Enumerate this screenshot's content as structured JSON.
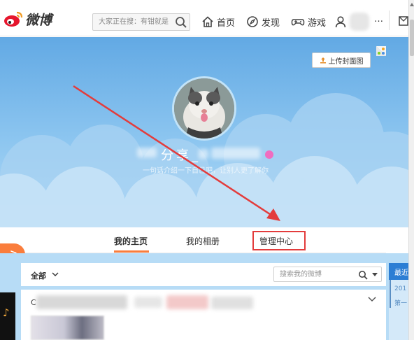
{
  "brand": {
    "logo_text": "微博"
  },
  "topnav": {
    "search_placeholder": "大家正在搜：有钳就是",
    "items": [
      {
        "label": "首页",
        "icon": "home-icon"
      },
      {
        "label": "发现",
        "icon": "compass-icon"
      },
      {
        "label": "游戏",
        "icon": "gamepad-icon"
      }
    ],
    "user_suffix": "…"
  },
  "banner": {
    "upload_cover_label": "上传封面图",
    "profile_name": "分享_",
    "bio": "一句话介绍一下自己吧，让别人更了解你"
  },
  "tabs": [
    {
      "label": "我的主页",
      "active": true
    },
    {
      "label": "我的相册",
      "active": false
    },
    {
      "label": "管理中心",
      "active": false,
      "highlighted": true
    }
  ],
  "side_toggle_label": ">",
  "feed": {
    "filter_label": "全部",
    "search_placeholder": "搜索我的微博",
    "post_initial": "C"
  },
  "side_panel": {
    "header": "最近",
    "line1": "201",
    "line2": "第一"
  },
  "music_icon_label": "♪",
  "colors": {
    "accent_orange": "#fa7d3c",
    "highlight_red": "#e33c3c",
    "banner_blue": "#62a9e4",
    "side_header_blue": "#2c7ed4"
  }
}
